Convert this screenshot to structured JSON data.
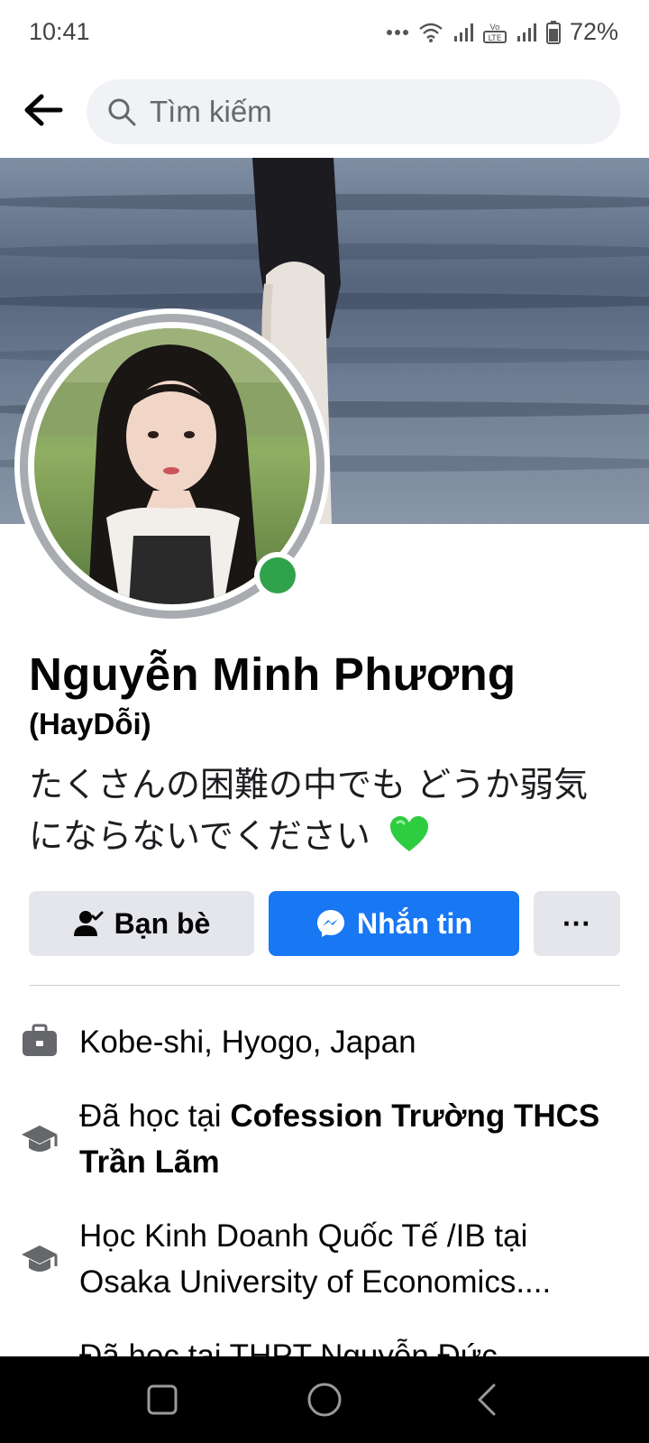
{
  "status_bar": {
    "time": "10:41",
    "battery_percent": "72%",
    "icons": [
      "more-dots-icon",
      "wifi-icon",
      "signal-icon",
      "volte-icon",
      "signal-icon",
      "battery-icon"
    ]
  },
  "header": {
    "back_icon": "arrow-left-icon",
    "search_placeholder": "Tìm kiếm"
  },
  "profile": {
    "name": "Nguyễn Minh Phương",
    "alternate_name": "(HayDỗi)",
    "bio_line1": "たくさんの困難の中でも どうか弱気",
    "bio_line2": "にならないでください",
    "online": true
  },
  "actions": {
    "friends_label": "Bạn bè",
    "message_label": "Nhắn tin",
    "more_label": "···"
  },
  "info": [
    {
      "icon": "briefcase-icon",
      "text": "Kobe-shi, Hyogo, Japan"
    },
    {
      "icon": "graduation-cap-icon",
      "prefix": "Đã học tại ",
      "bold": "Cofession Trường THCS Trần Lãm"
    },
    {
      "icon": "graduation-cap-icon",
      "text": "Học Kinh Doanh Quốc Tế /IB tại Osaka University of Economics...."
    },
    {
      "icon": "graduation-cap-icon",
      "text": "Đã học tại THPT Nguyễn Đức"
    }
  ],
  "colors": {
    "accent": "#1877f2",
    "online": "#31a24c",
    "button_gray": "#e4e6eb",
    "heart": "#2ecc40"
  }
}
